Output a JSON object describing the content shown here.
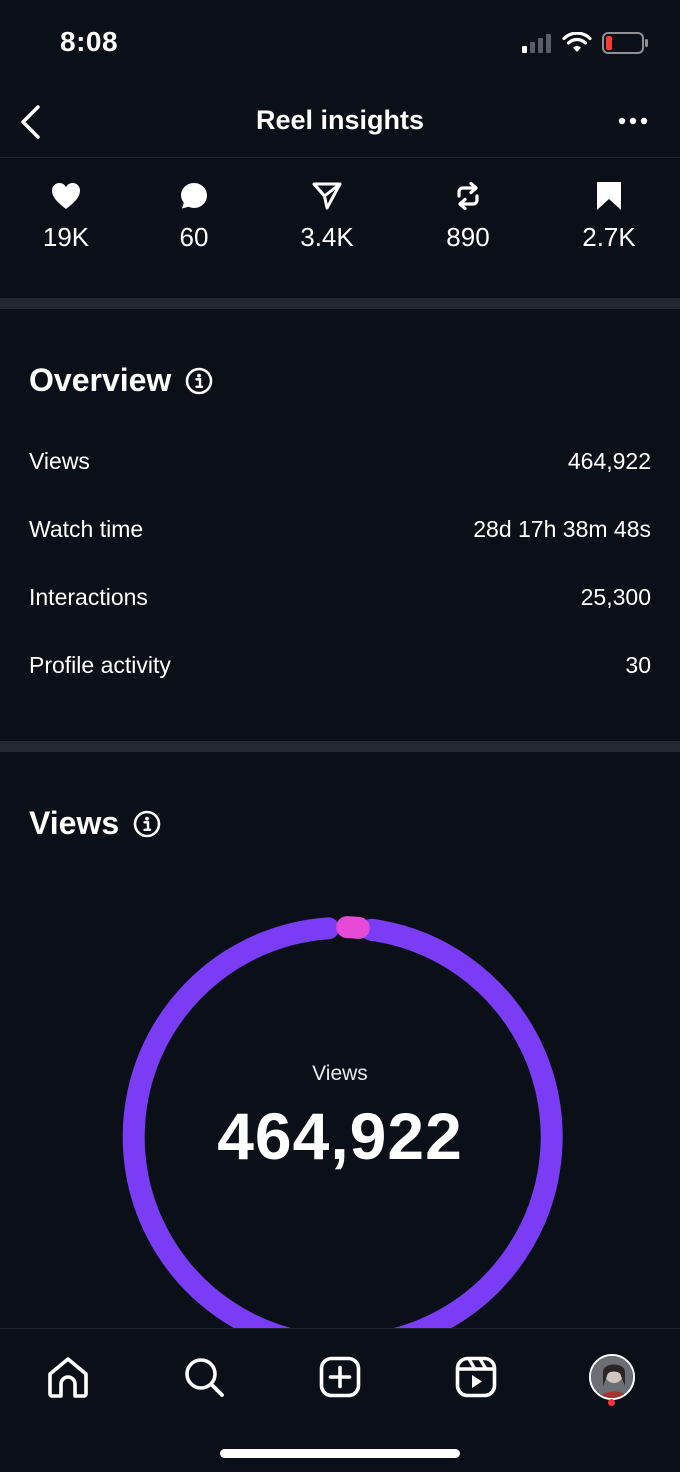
{
  "status_bar": {
    "time": "8:08",
    "battery_color": "#ff3b30"
  },
  "header": {
    "title": "Reel insights",
    "back_icon": "chevron-left-icon",
    "more_icon": "more-horizontal-icon"
  },
  "stats": [
    {
      "icon": "heart-icon",
      "value": "19K"
    },
    {
      "icon": "comment-icon",
      "value": "60"
    },
    {
      "icon": "share-icon",
      "value": "3.4K"
    },
    {
      "icon": "repost-icon",
      "value": "890"
    },
    {
      "icon": "bookmark-icon",
      "value": "2.7K"
    }
  ],
  "overview": {
    "title": "Overview",
    "rows": [
      {
        "label": "Views",
        "value": "464,922"
      },
      {
        "label": "Watch time",
        "value": "28d 17h 38m 48s"
      },
      {
        "label": "Interactions",
        "value": "25,300"
      },
      {
        "label": "Profile activity",
        "value": "30"
      }
    ]
  },
  "views_section": {
    "title": "Views",
    "donut_label": "Views",
    "donut_value": "464,922",
    "colors": {
      "primary": "#7a3cf5",
      "secondary": "#e84ad8"
    }
  },
  "tab_bar": {
    "tabs": [
      "home-icon",
      "search-icon",
      "create-icon",
      "reels-icon",
      "profile-avatar"
    ],
    "notification_dot_color": "#ff3040"
  }
}
